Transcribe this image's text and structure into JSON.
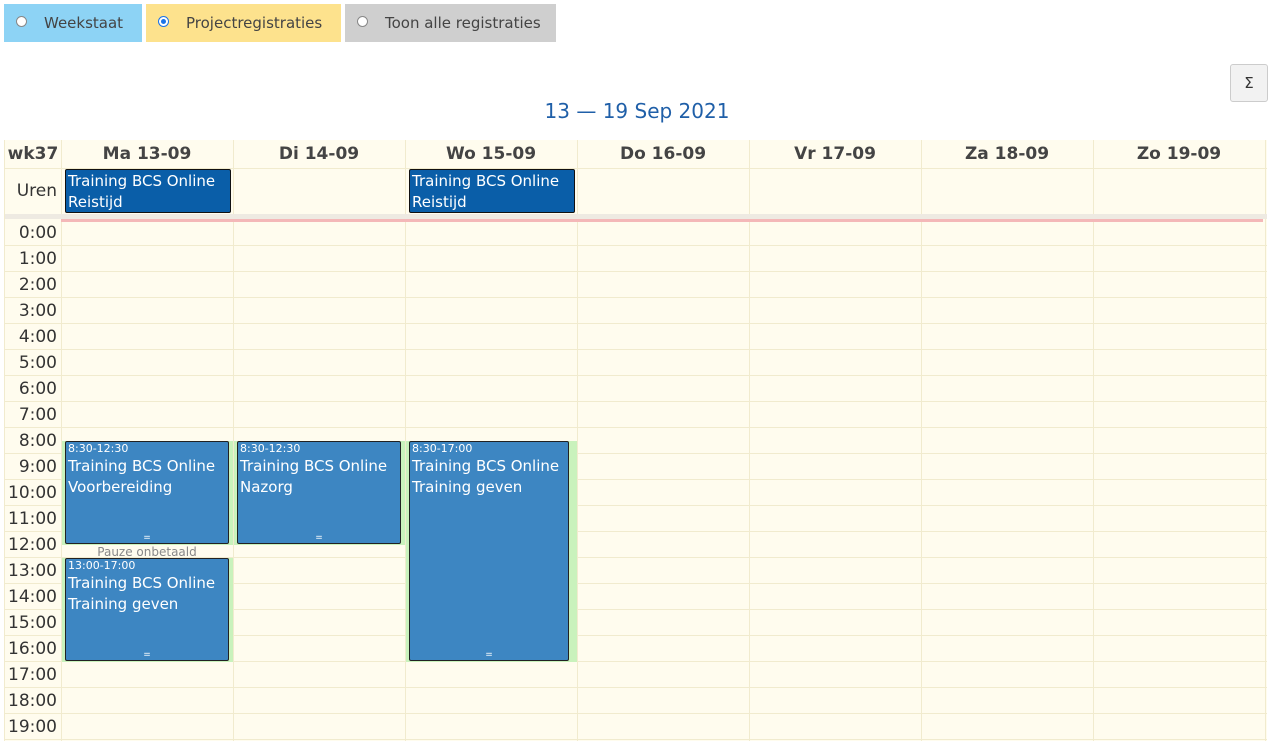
{
  "tabs": {
    "weekstaat": "Weekstaat",
    "project": "Projectregistraties",
    "all": "Toon alle registraties",
    "selected": "Projectregistraties"
  },
  "sum_button": "Σ",
  "week_title": "13 — 19 Sep 2021",
  "week_number": "wk37",
  "allday_label": "Uren",
  "days": [
    "Ma 13-09",
    "Di 14-09",
    "Wo 15-09",
    "Do 16-09",
    "Vr 17-09",
    "Za 18-09",
    "Zo 19-09"
  ],
  "hours": [
    "0:00",
    "1:00",
    "2:00",
    "3:00",
    "4:00",
    "5:00",
    "6:00",
    "7:00",
    "8:00",
    "9:00",
    "10:00",
    "11:00",
    "12:00",
    "13:00",
    "14:00",
    "15:00",
    "16:00",
    "17:00",
    "18:00",
    "19:00"
  ],
  "allday_events": [
    {
      "day": "Ma 13-09",
      "line1": "Training BCS Online",
      "line2": "Reistijd"
    },
    {
      "day": "Wo 15-09",
      "line1": "Training BCS Online",
      "line2": "Reistijd"
    }
  ],
  "events": [
    {
      "day": "Ma 13-09",
      "start": 8.5,
      "end": 12.5,
      "time": "8:30-12:30",
      "line1": "Training BCS Online",
      "line2": "Voorbereiding",
      "handle": "="
    },
    {
      "day": "Di 14-09",
      "start": 8.5,
      "end": 12.5,
      "time": "8:30-12:30",
      "line1": "Training BCS Online",
      "line2": "Nazorg",
      "handle": "="
    },
    {
      "day": "Wo 15-09",
      "start": 8.5,
      "end": 17,
      "time": "8:30-17:00",
      "line1": "Training BCS Online",
      "line2": "Training geven",
      "handle": "="
    },
    {
      "day": "Ma 13-09",
      "start": 13,
      "end": 17,
      "time": "13:00-17:00",
      "line1": "Training BCS Online",
      "line2": "Training geven",
      "handle": "="
    }
  ],
  "pause_label": "Pauze onbetaald",
  "colors": {
    "tab_weekstaat": "#8dd3f5",
    "tab_project": "#fde28d",
    "tab_all": "#cfcfcf",
    "event": "#3d86c2",
    "allday_event": "#0a5ea8",
    "worked_hours": "#c9f2bc",
    "title": "#1f5fa8"
  }
}
